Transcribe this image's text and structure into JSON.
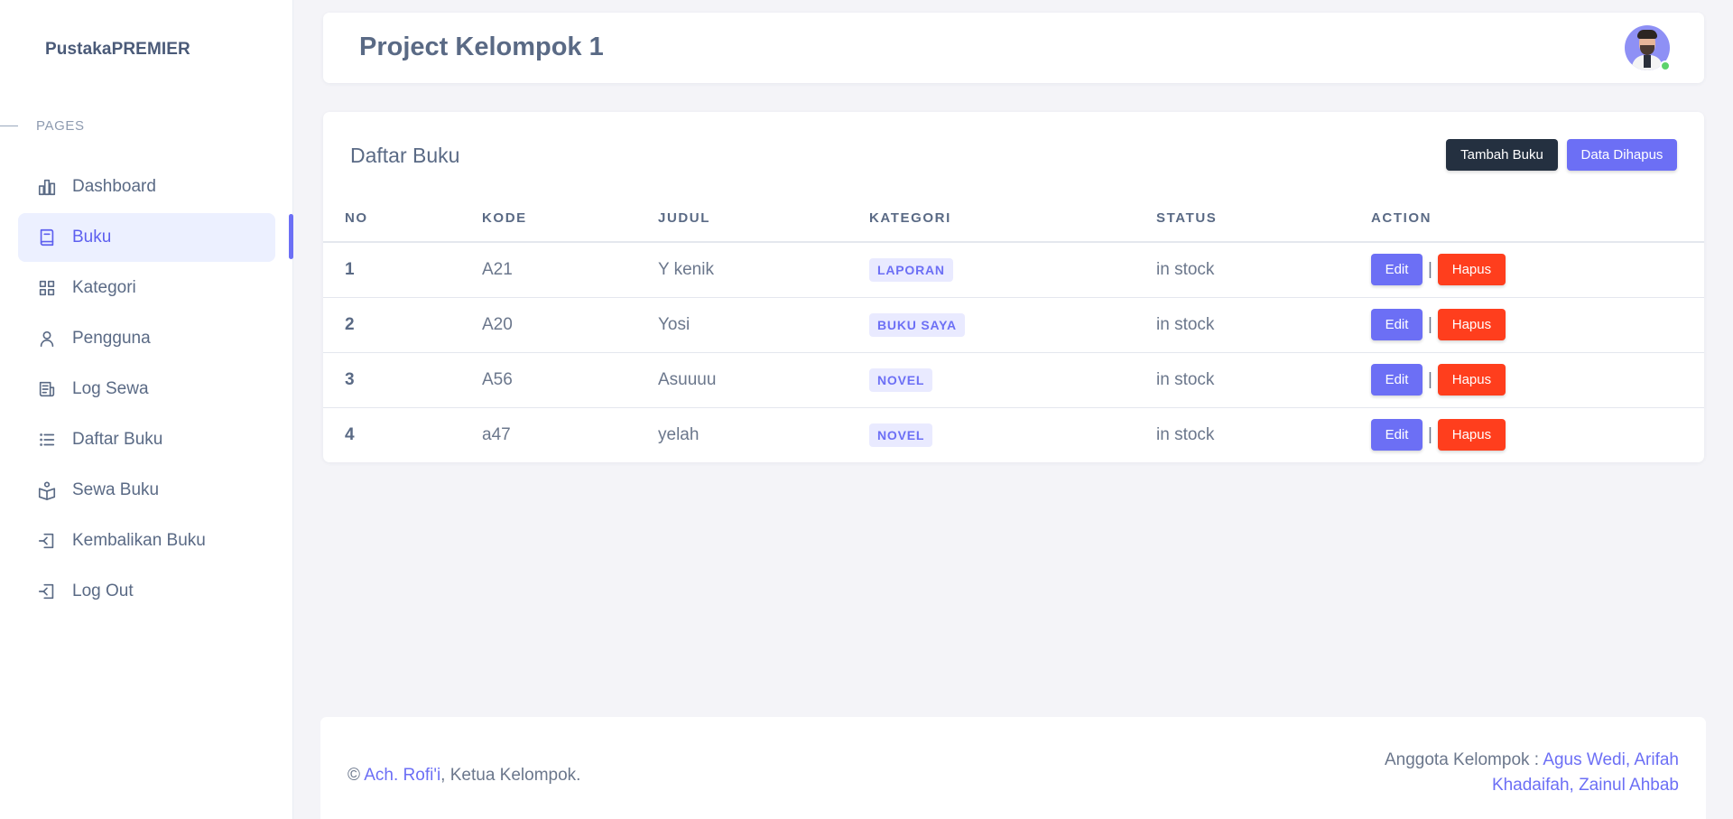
{
  "brand": "PustakaPREMIER",
  "sidebar": {
    "section_label": "PAGES",
    "items": [
      {
        "label": "Dashboard",
        "icon": "bar-chart-icon"
      },
      {
        "label": "Buku",
        "icon": "book-icon"
      },
      {
        "label": "Kategori",
        "icon": "grid-icon"
      },
      {
        "label": "Pengguna",
        "icon": "user-icon"
      },
      {
        "label": "Log Sewa",
        "icon": "receipt-icon"
      },
      {
        "label": "Daftar Buku",
        "icon": "list-icon"
      },
      {
        "label": "Sewa Buku",
        "icon": "book-open-user-icon"
      },
      {
        "label": "Kembalikan Buku",
        "icon": "logout-icon"
      },
      {
        "label": "Log Out",
        "icon": "logout-icon"
      }
    ],
    "active_index": 1
  },
  "header": {
    "title": "Project Kelompok 1"
  },
  "card": {
    "title": "Daftar Buku",
    "add_button": "Tambah Buku",
    "deleted_button": "Data Dihapus",
    "columns": [
      "NO",
      "KODE",
      "JUDUL",
      "KATEGORI",
      "STATUS",
      "ACTION"
    ],
    "rows": [
      {
        "no": "1",
        "kode": "A21",
        "judul": "Y kenik",
        "kategori": "LAPORAN",
        "status": "in stock"
      },
      {
        "no": "2",
        "kode": "A20",
        "judul": "Yosi",
        "kategori": "BUKU SAYA",
        "status": "in stock"
      },
      {
        "no": "3",
        "kode": "A56",
        "judul": "Asuuuu",
        "kategori": "NOVEL",
        "status": "in stock"
      },
      {
        "no": "4",
        "kode": "a47",
        "judul": "yelah",
        "kategori": "NOVEL",
        "status": "in stock"
      }
    ],
    "edit_label": "Edit",
    "delete_label": "Hapus",
    "separator": "|"
  },
  "footer": {
    "copyright_symbol": "©",
    "leader_name": "Ach. Rofi'i",
    "leader_suffix": ", Ketua Kelompok.",
    "members_prefix": "Anggota Kelompok : ",
    "members": [
      "Agus Wedi",
      "Arifah Khadaifah",
      "Zainul Ahbab"
    ]
  },
  "colors": {
    "accent": "#6c6ff5",
    "danger": "#ff3e1d",
    "dark_button": "#243040",
    "online": "#5dd36b"
  }
}
